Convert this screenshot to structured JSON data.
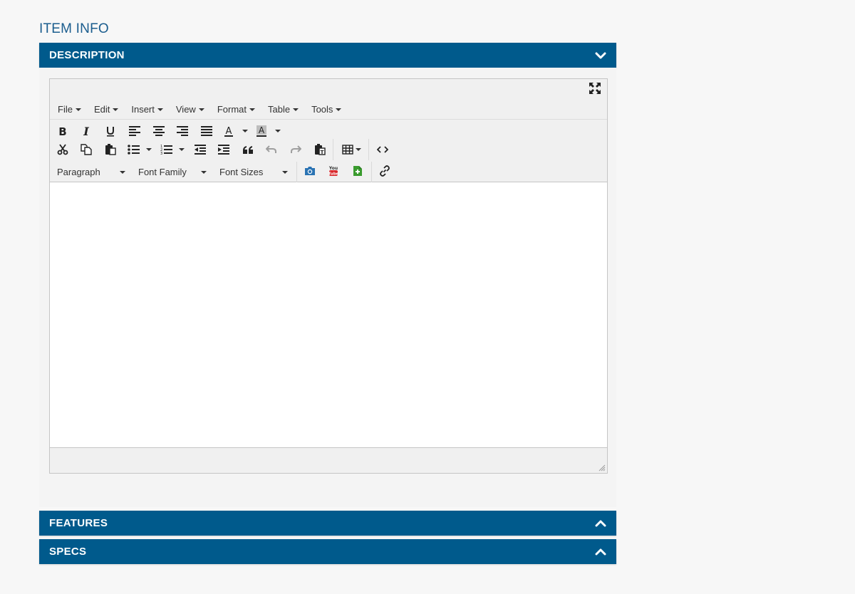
{
  "page": {
    "section_title": "ITEM INFO"
  },
  "panels": [
    {
      "label": "DESCRIPTION",
      "state": "expanded"
    },
    {
      "label": "FEATURES",
      "state": "collapsed"
    },
    {
      "label": "SPECS",
      "state": "collapsed"
    }
  ],
  "editor": {
    "menubar": [
      "File",
      "Edit",
      "Insert",
      "View",
      "Format",
      "Table",
      "Tools"
    ],
    "block_format": "Paragraph",
    "font_family": "Font Family",
    "font_size": "Font Sizes",
    "content": ""
  },
  "colors": {
    "panel_header": "#005a8c",
    "section_title": "#1b5d8e",
    "camera_icon": "#2a73b3",
    "youtube_icon": "#d9262a",
    "doc_icon": "#3a9b2e"
  },
  "icons": {
    "panel_expanded": "chevron-down-icon",
    "panel_collapsed": "chevron-up-icon",
    "fullscreen": "fullscreen-icon",
    "toolbar_row1": [
      "bold-icon",
      "italic-icon",
      "underline-icon",
      "align-left-icon",
      "align-center-icon",
      "align-right-icon",
      "align-justify-icon",
      "text-color-icon",
      "background-color-icon"
    ],
    "toolbar_row2": [
      "cut-icon",
      "copy-icon",
      "paste-icon",
      "bullet-list-icon",
      "numbered-list-icon",
      "outdent-icon",
      "indent-icon",
      "blockquote-icon",
      "undo-icon",
      "redo-icon",
      "paste-text-icon",
      "table-icon",
      "source-code-icon"
    ],
    "toolbar_row3": [
      "camera-icon",
      "youtube-icon",
      "insert-document-icon",
      "link-icon"
    ]
  }
}
